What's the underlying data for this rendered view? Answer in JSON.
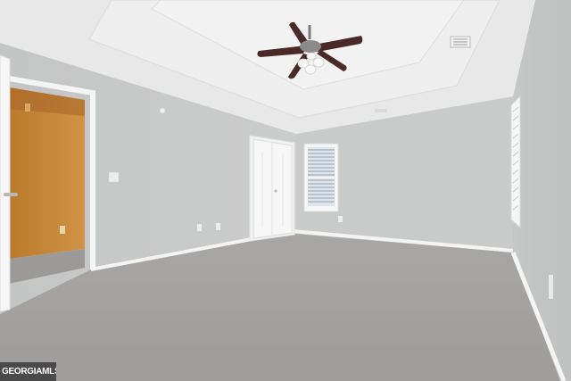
{
  "photo": {
    "subject": "empty-bedroom-interior",
    "colors": {
      "wall": "#c7c8c8",
      "ceiling": "#ebebeb",
      "carpet": "#a4a2a0",
      "trim": "#f5f5f5",
      "closet_interior": "#c98a36",
      "fan_blade": "#4a2a26"
    }
  },
  "watermark": {
    "text": "GEORGIAMLS"
  }
}
